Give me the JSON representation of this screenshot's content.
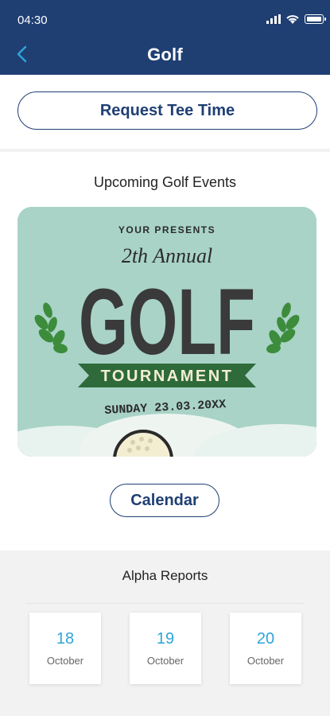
{
  "status_bar": {
    "time": "04:30"
  },
  "header": {
    "title": "Golf"
  },
  "actions": {
    "request_tee_time": "Request Tee Time",
    "calendar": "Calendar"
  },
  "events": {
    "heading": "Upcoming Golf Events",
    "poster": {
      "presenter": "YOUR PRESENTS",
      "annual": "2th Annual",
      "main": "GOLF",
      "banner": "TOURNAMENT",
      "date": "SUNDAY 23.03.20XX"
    }
  },
  "reports": {
    "title": "Alpha Reports",
    "items": [
      {
        "day": "18",
        "month": "October"
      },
      {
        "day": "19",
        "month": "October"
      },
      {
        "day": "20",
        "month": "October"
      }
    ]
  },
  "colors": {
    "header": "#1f3f73",
    "accent": "#2ea5d9",
    "poster_bg": "#a9d3c7",
    "banner_green": "#2e6a3a"
  }
}
